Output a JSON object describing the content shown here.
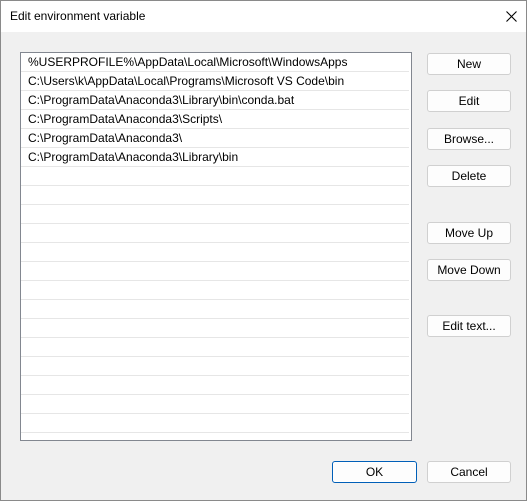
{
  "window": {
    "title": "Edit environment variable",
    "close_icon": "close-icon"
  },
  "paths": [
    "%USERPROFILE%\\AppData\\Local\\Microsoft\\WindowsApps",
    "C:\\Users\\k\\AppData\\Local\\Programs\\Microsoft VS Code\\bin",
    "C:\\ProgramData\\Anaconda3\\Library\\bin\\conda.bat",
    "C:\\ProgramData\\Anaconda3\\Scripts\\",
    "C:\\ProgramData\\Anaconda3\\",
    "C:\\ProgramData\\Anaconda3\\Library\\bin"
  ],
  "buttons": {
    "new": "New",
    "edit": "Edit",
    "browse": "Browse...",
    "delete": "Delete",
    "move_up": "Move Up",
    "move_down": "Move Down",
    "edit_text": "Edit text...",
    "ok": "OK",
    "cancel": "Cancel"
  },
  "colors": {
    "dialog_background": "#f0f0f0",
    "titlebar_background": "#ffffff",
    "list_background": "#ffffff",
    "default_button_border": "#005fb8"
  }
}
